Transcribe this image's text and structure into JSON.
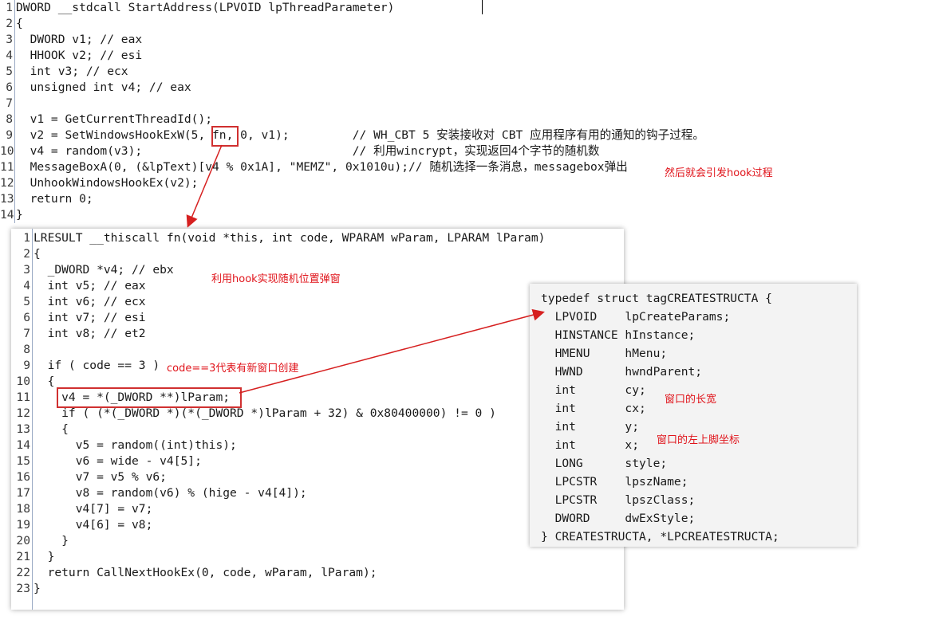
{
  "top_func": {
    "line_numbers": [
      "1",
      "2",
      "3",
      "4",
      "5",
      "6",
      "7",
      "8",
      "9",
      "10",
      "11",
      "12",
      "13",
      "14"
    ],
    "lines": [
      "DWORD __stdcall StartAddress(LPVOID lpThreadParameter)",
      "{",
      "  DWORD v1; // eax",
      "  HHOOK v2; // esi",
      "  int v3; // ecx",
      "  unsigned int v4; // eax",
      "",
      "  v1 = GetCurrentThreadId();",
      "  v2 = SetWindowsHookExW(5, fn, 0, v1);         // WH_CBT 5 安装接收对 CBT 应用程序有用的通知的钩子过程。",
      "  v4 = random(v3);                              // 利用wincrypt，实现返回4个字节的随机数",
      "  MessageBoxA(0, (&lpText)[v4 % 0x1A], \"MEMZ\", 0x1010u);// 随机选择一条消息，messagebox弹出",
      "  UnhookWindowsHookEx(v2);",
      "  return 0;",
      "}"
    ]
  },
  "hook_func": {
    "line_numbers": [
      "1",
      "2",
      "3",
      "4",
      "5",
      "6",
      "7",
      "8",
      "9",
      "10",
      "11",
      "12",
      "13",
      "14",
      "15",
      "16",
      "17",
      "18",
      "19",
      "20",
      "21",
      "22",
      "23"
    ],
    "lines": [
      "LRESULT __thiscall fn(void *this, int code, WPARAM wParam, LPARAM lParam)",
      "{",
      "  _DWORD *v4; // ebx",
      "  int v5; // eax",
      "  int v6; // ecx",
      "  int v7; // esi",
      "  int v8; // et2",
      "",
      "  if ( code == 3 )",
      "  {",
      "    v4 = *(_DWORD **)lParam;",
      "    if ( (*(_DWORD *)(*(_DWORD *)lParam + 32) & 0x80400000) != 0 )",
      "    {",
      "      v5 = random((int)this);",
      "      v6 = wide - v4[5];",
      "      v7 = v5 % v6;",
      "      v8 = random(v6) % (hige - v4[4]);",
      "      v4[7] = v7;",
      "      v4[6] = v8;",
      "    }",
      "  }",
      "  return CallNextHookEx(0, code, wParam, lParam);",
      "}"
    ]
  },
  "struct_popup": {
    "lines": [
      "typedef struct tagCREATESTRUCTA {",
      "  LPVOID    lpCreateParams;",
      "  HINSTANCE hInstance;",
      "  HMENU     hMenu;",
      "  HWND      hwndParent;",
      "  int       cy;",
      "  int       cx;",
      "  int       y;",
      "  int       x;",
      "  LONG      style;",
      "  LPCSTR    lpszName;",
      "  LPCSTR    lpszClass;",
      "  DWORD     dwExStyle;",
      "} CREATESTRUCTA, *LPCREATESTRUCTA;"
    ]
  },
  "annotations": {
    "hook_trigger": "然后就会引发hook过程",
    "random_popup": "利用hook实现随机位置弹窗",
    "code3": "code==3代表有新窗口创建",
    "size": "窗口的长宽",
    "position": "窗口的左上脚坐标"
  },
  "colors": {
    "annotation": "#e0141b",
    "function": "#e0156b",
    "comment": "#1a5fb4",
    "variable": "#8a8aa8"
  }
}
